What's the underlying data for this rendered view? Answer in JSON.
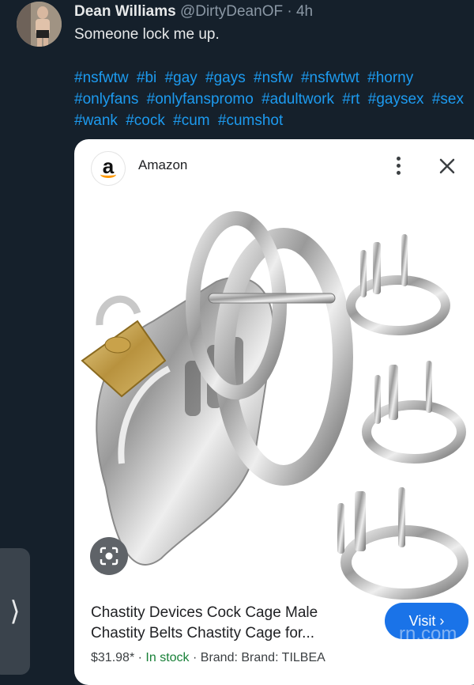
{
  "tweet": {
    "author_name": "Dean Williams",
    "handle": "@DirtyDeanOF",
    "separator": "·",
    "time": "4h",
    "text": "Someone lock me up.",
    "hashtags": [
      "#nsfwtw",
      "#bi",
      "#gay",
      "#gays",
      "#nsfw",
      "#nsfwtwt",
      "#horny",
      "#onlyfans",
      "#onlyfanspromo",
      "#adultwork",
      "#rt",
      "#gaysex",
      "#sex",
      "#wank",
      "#cock",
      "#cum",
      "#cumshot"
    ]
  },
  "card": {
    "source": "Amazon",
    "logo_letter": "a",
    "product_title": "Chastity Devices Cock Cage Male Chastity Belts Chastity Cage for...",
    "price": "$31.98*",
    "separator": "·",
    "stock": "In stock",
    "brand": "Brand: Brand: TILBEA",
    "visit_label": "Visit ›"
  },
  "watermark": "rn.com",
  "colors": {
    "background": "#15202b",
    "hashtag": "#1d9bf0",
    "visit_button": "#1a73e8",
    "in_stock": "#188038"
  },
  "icons": [
    "more-vert-icon",
    "close-icon",
    "lens-icon",
    "chevron-right-icon"
  ]
}
